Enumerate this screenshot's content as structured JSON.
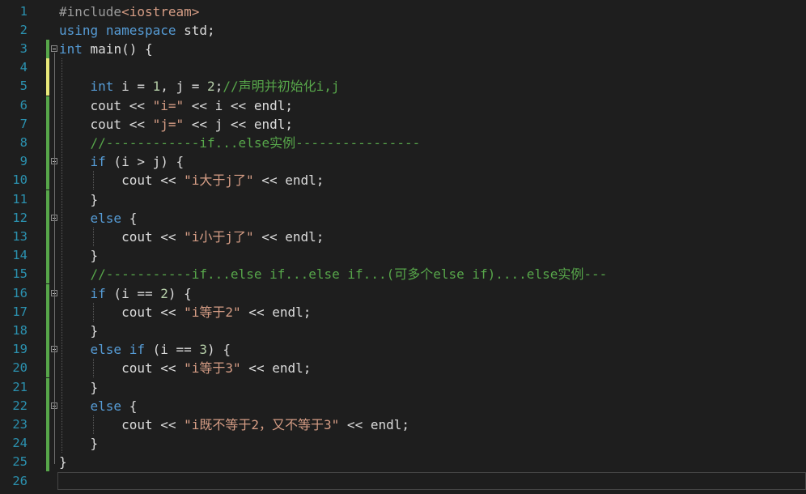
{
  "editor": {
    "lines": [
      {
        "n": "1",
        "parts": [
          {
            "t": "#include",
            "c": "pp"
          },
          {
            "t": "<iostream>",
            "c": "str"
          }
        ]
      },
      {
        "n": "2",
        "parts": [
          {
            "t": "using",
            "c": "kw"
          },
          {
            "t": " "
          },
          {
            "t": "namespace",
            "c": "kw"
          },
          {
            "t": " std;"
          }
        ]
      },
      {
        "n": "3",
        "parts": [
          {
            "t": "int",
            "c": "kw"
          },
          {
            "t": " main() {"
          }
        ]
      },
      {
        "n": "4",
        "parts": []
      },
      {
        "n": "5",
        "parts": [
          {
            "t": "    "
          },
          {
            "t": "int",
            "c": "kw"
          },
          {
            "t": " i = "
          },
          {
            "t": "1",
            "c": "num"
          },
          {
            "t": ", j = "
          },
          {
            "t": "2",
            "c": "num"
          },
          {
            "t": ";"
          },
          {
            "t": "//声明并初始化i,j",
            "c": "cmt"
          }
        ]
      },
      {
        "n": "6",
        "parts": [
          {
            "t": "    cout << "
          },
          {
            "t": "\"i=\"",
            "c": "str"
          },
          {
            "t": " << i << endl;"
          }
        ]
      },
      {
        "n": "7",
        "parts": [
          {
            "t": "    cout << "
          },
          {
            "t": "\"j=\"",
            "c": "str"
          },
          {
            "t": " << j << endl;"
          }
        ]
      },
      {
        "n": "8",
        "parts": [
          {
            "t": "    "
          },
          {
            "t": "//------------if...else实例----------------",
            "c": "cmt"
          }
        ]
      },
      {
        "n": "9",
        "parts": [
          {
            "t": "    "
          },
          {
            "t": "if",
            "c": "kw"
          },
          {
            "t": " (i > j) {"
          }
        ]
      },
      {
        "n": "10",
        "parts": [
          {
            "t": "        cout << "
          },
          {
            "t": "\"i大于j了\"",
            "c": "str"
          },
          {
            "t": " << endl;"
          }
        ]
      },
      {
        "n": "11",
        "parts": [
          {
            "t": "    }"
          }
        ]
      },
      {
        "n": "12",
        "parts": [
          {
            "t": "    "
          },
          {
            "t": "else",
            "c": "kw"
          },
          {
            "t": " {"
          }
        ]
      },
      {
        "n": "13",
        "parts": [
          {
            "t": "        cout << "
          },
          {
            "t": "\"i小于j了\"",
            "c": "str"
          },
          {
            "t": " << endl;"
          }
        ]
      },
      {
        "n": "14",
        "parts": [
          {
            "t": "    }"
          }
        ]
      },
      {
        "n": "15",
        "parts": [
          {
            "t": "    "
          },
          {
            "t": "//-----------if...else if...else if...(可多个else if)....else实例---",
            "c": "cmt"
          }
        ]
      },
      {
        "n": "16",
        "parts": [
          {
            "t": "    "
          },
          {
            "t": "if",
            "c": "kw"
          },
          {
            "t": " (i == "
          },
          {
            "t": "2",
            "c": "num"
          },
          {
            "t": ") {"
          }
        ]
      },
      {
        "n": "17",
        "parts": [
          {
            "t": "        cout << "
          },
          {
            "t": "\"i等于2\"",
            "c": "str"
          },
          {
            "t": " << endl;"
          }
        ]
      },
      {
        "n": "18",
        "parts": [
          {
            "t": "    }"
          }
        ]
      },
      {
        "n": "19",
        "parts": [
          {
            "t": "    "
          },
          {
            "t": "else",
            "c": "kw"
          },
          {
            "t": " "
          },
          {
            "t": "if",
            "c": "kw"
          },
          {
            "t": " (i == "
          },
          {
            "t": "3",
            "c": "num"
          },
          {
            "t": ") {"
          }
        ]
      },
      {
        "n": "20",
        "parts": [
          {
            "t": "        cout << "
          },
          {
            "t": "\"i等于3\"",
            "c": "str"
          },
          {
            "t": " << endl;"
          }
        ]
      },
      {
        "n": "21",
        "parts": [
          {
            "t": "    }"
          }
        ]
      },
      {
        "n": "22",
        "parts": [
          {
            "t": "    "
          },
          {
            "t": "else",
            "c": "kw"
          },
          {
            "t": " {"
          }
        ]
      },
      {
        "n": "23",
        "parts": [
          {
            "t": "        cout << "
          },
          {
            "t": "\"i既不等于2，又不等于3\"",
            "c": "str"
          },
          {
            "t": " << endl;"
          }
        ]
      },
      {
        "n": "24",
        "parts": [
          {
            "t": "    }"
          }
        ]
      },
      {
        "n": "25",
        "parts": [
          {
            "t": "}"
          }
        ]
      },
      {
        "n": "26",
        "parts": []
      }
    ],
    "fold_lines": [
      "3",
      "9",
      "12",
      "16",
      "19",
      "22"
    ],
    "changed_lines": [
      "3",
      "4",
      "5",
      "6",
      "7",
      "8",
      "9",
      "10",
      "11",
      "12",
      "13",
      "14",
      "15",
      "16",
      "17",
      "18",
      "19",
      "20",
      "21",
      "22",
      "23",
      "24",
      "25"
    ],
    "current_line": "26",
    "colors": {
      "background": "#1e1e1e",
      "line_number": "#2b91af",
      "keyword": "#569cd6",
      "string": "#d69d85",
      "number": "#b5cea8",
      "comment": "#57a64a",
      "preprocessor": "#9b9b9b",
      "text": "#dcdcdc"
    }
  }
}
